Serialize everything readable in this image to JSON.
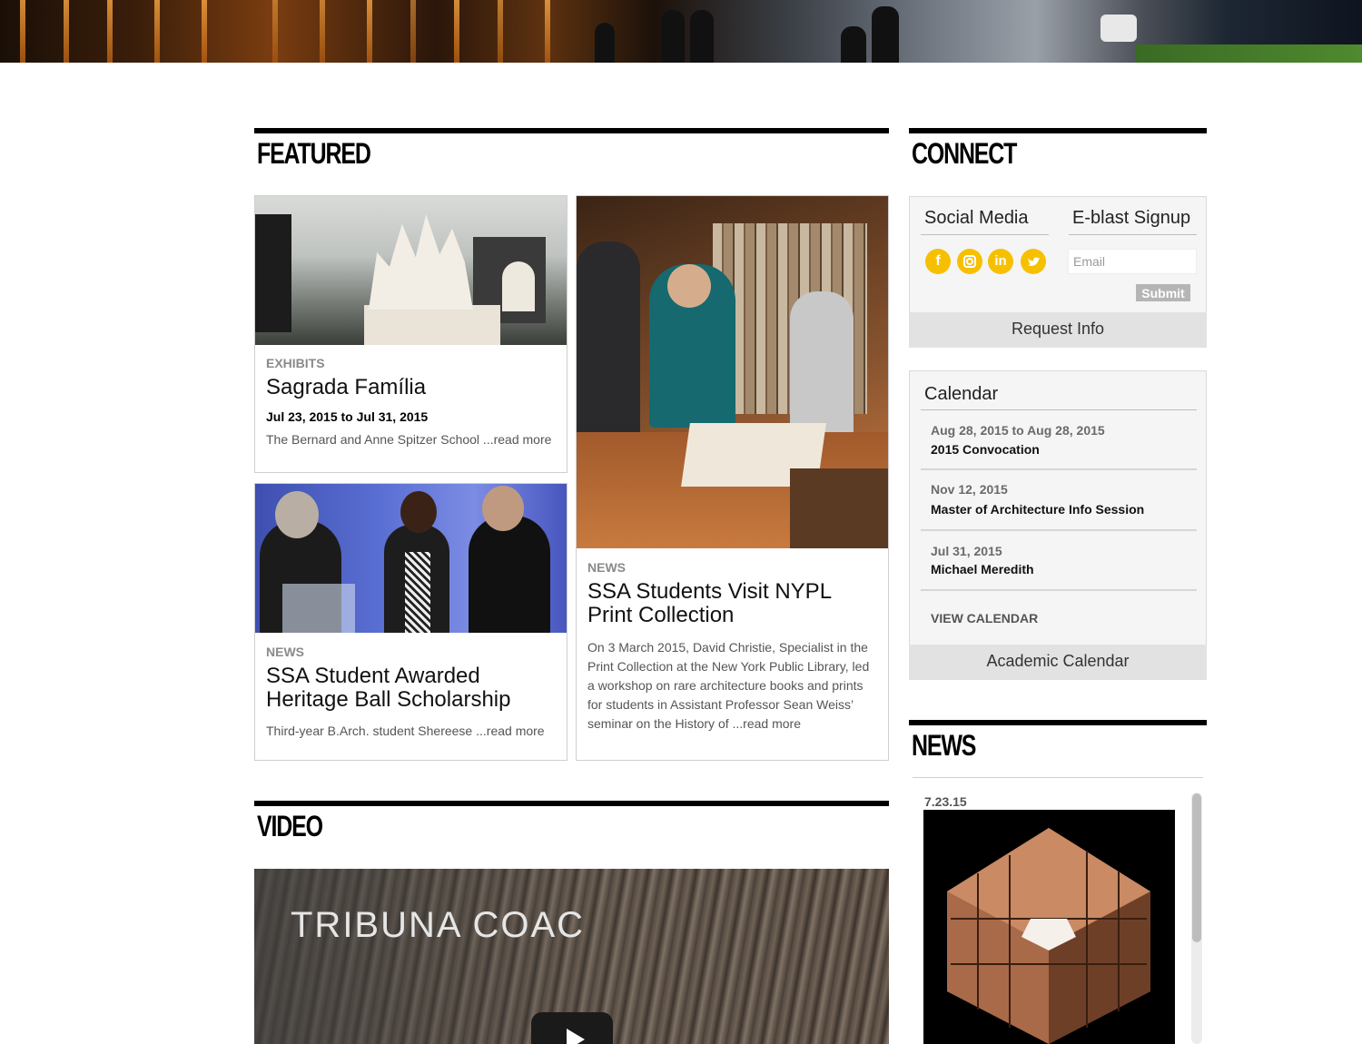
{
  "sections": {
    "featured": "FEATURED",
    "connect": "CONNECT",
    "video": "VIDEO",
    "news": "NEWS"
  },
  "featured": [
    {
      "category": "EXHIBITS",
      "title": "Sagrada Família",
      "date": "Jul 23, 2015 to Jul 31, 2015",
      "description": "The Bernard and Anne Spitzer School ...read more"
    },
    {
      "category": "NEWS",
      "title": "SSA Students Visit NYPL Print Collection",
      "description": "On 3 March 2015, David Christie, Specialist in the Print Collection at the New York Public Library, led a workshop on rare architecture books and prints for students in Assistant Professor Sean Weiss’ seminar on the History of ...read more"
    },
    {
      "category": "NEWS",
      "title": "SSA Student Awarded Heritage Ball Scholarship",
      "description": "Third-year B.Arch. student Shereese ...read more"
    }
  ],
  "connect": {
    "social_label": "Social Media",
    "eblast_label": "E-blast Signup",
    "email_placeholder": "Email",
    "submit_label": "Submit",
    "request_info": "Request Info",
    "social_icons": [
      "facebook-icon",
      "instagram-icon",
      "linkedin-icon",
      "twitter-icon"
    ],
    "accent_color": "#f6c000"
  },
  "calendar": {
    "title": "Calendar",
    "events": [
      {
        "date": "Aug 28, 2015 to Aug 28, 2015",
        "title": "2015 Convocation"
      },
      {
        "date": "Nov 12, 2015",
        "title": "Master of Architecture Info Session"
      },
      {
        "date": "Jul 31, 2015",
        "title": "Michael Meredith"
      }
    ],
    "view_calendar": "VIEW CALENDAR",
    "academic_calendar": "Academic Calendar"
  },
  "video": {
    "overlay_title": "TRIBUNA COAC"
  },
  "news": {
    "items": [
      {
        "date": "7.23.15"
      }
    ]
  }
}
